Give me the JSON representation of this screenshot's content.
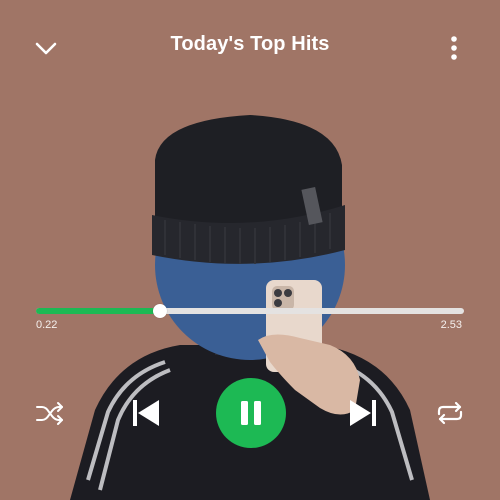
{
  "header": {
    "title": "Today's Top Hits",
    "collapse_icon": "chevron-down-icon",
    "options_icon": "more-vertical-icon"
  },
  "player": {
    "elapsed": "0.22",
    "total": "2.53",
    "progress_fraction": 0.29
  },
  "controls": {
    "shuffle_icon": "shuffle-icon",
    "previous_icon": "skip-previous-icon",
    "play_pause_icon": "pause-icon",
    "next_icon": "skip-next-icon",
    "repeat_icon": "repeat-icon"
  },
  "colors": {
    "background": "#a07566",
    "accent": "#1db954",
    "track": "#e4e2e1",
    "text": "#ffffff"
  }
}
